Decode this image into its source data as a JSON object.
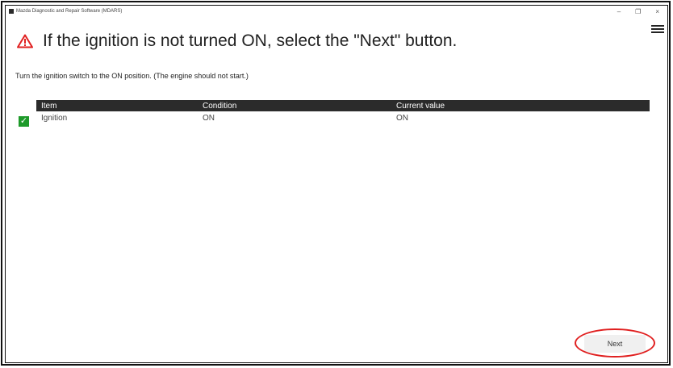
{
  "window": {
    "title": "Mazda Diagnostic and Repair Software (MDARS)",
    "minimize": "–",
    "restore": "❐",
    "close": "×"
  },
  "heading": "If the ignition is not turned ON, select the \"Next\" button.",
  "instruction": "Turn the ignition switch to the ON position.  (The engine should not start.)",
  "table": {
    "headers": [
      "Item",
      "Condition",
      "Current value"
    ],
    "rows": [
      {
        "checked": true,
        "item": "Ignition",
        "condition": "ON",
        "current": "ON"
      }
    ]
  },
  "buttons": {
    "next": "Next"
  },
  "colors": {
    "accent_red": "#e02020",
    "check_green": "#1e9a2a",
    "header_dark": "#2b2b2b"
  },
  "icons": {
    "warning": "warning-triangle-icon",
    "menu": "hamburger-menu-icon",
    "check": "checkmark-icon"
  }
}
